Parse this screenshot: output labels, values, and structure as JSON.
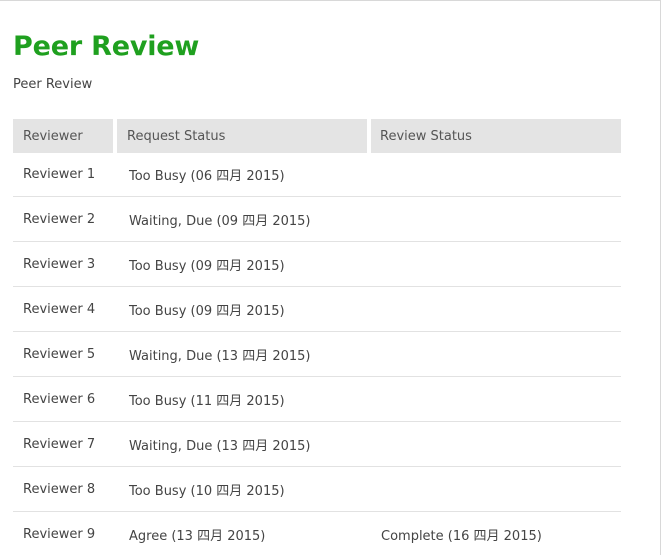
{
  "page": {
    "title": "Peer Review",
    "subtitle": "Peer Review"
  },
  "table": {
    "headers": {
      "reviewer": "Reviewer",
      "request_status": "Request Status",
      "review_status": "Review Status"
    },
    "rows": [
      {
        "reviewer": "Reviewer 1",
        "request_status": "Too Busy (06 四月 2015)",
        "review_status": ""
      },
      {
        "reviewer": "Reviewer 2",
        "request_status": "Waiting, Due (09 四月 2015)",
        "review_status": ""
      },
      {
        "reviewer": "Reviewer 3",
        "request_status": "Too Busy (09 四月 2015)",
        "review_status": ""
      },
      {
        "reviewer": "Reviewer 4",
        "request_status": "Too Busy (09 四月 2015)",
        "review_status": ""
      },
      {
        "reviewer": "Reviewer 5",
        "request_status": "Waiting, Due (13 四月 2015)",
        "review_status": ""
      },
      {
        "reviewer": "Reviewer 6",
        "request_status": "Too Busy (11 四月 2015)",
        "review_status": ""
      },
      {
        "reviewer": "Reviewer 7",
        "request_status": "Waiting, Due (13 四月 2015)",
        "review_status": ""
      },
      {
        "reviewer": "Reviewer 8",
        "request_status": "Too Busy (10 四月 2015)",
        "review_status": ""
      },
      {
        "reviewer": "Reviewer 9",
        "request_status": "Agree (13 四月 2015)",
        "review_status": "Complete (16 四月 2015)"
      }
    ]
  },
  "colors": {
    "title": "#1fa01f",
    "header_bg": "#e4e4e4",
    "row_divider": "#e2e2e2"
  }
}
